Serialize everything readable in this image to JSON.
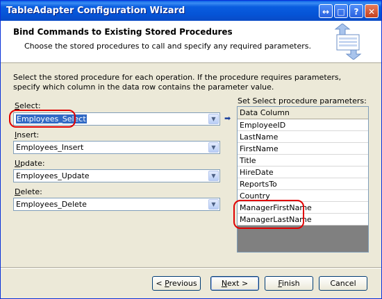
{
  "window": {
    "title": "TableAdapter Configuration Wizard"
  },
  "header": {
    "title": "Bind Commands to Existing Stored Procedures",
    "subtitle": "Choose the stored procedures to call and specify any required parameters."
  },
  "description": "Select the stored procedure for each operation. If the procedure requires parameters, specify which column in the data row contains the parameter value.",
  "fields": {
    "select": {
      "label": "Select:",
      "value": "Employees_Select"
    },
    "insert": {
      "label": "Insert:",
      "value": "Employees_Insert"
    },
    "update": {
      "label": "Update:",
      "value": "Employees_Update"
    },
    "delete": {
      "label": "Delete:",
      "value": "Employees_Delete"
    }
  },
  "params": {
    "label": "Set Select procedure parameters:",
    "column_header": "Data Column",
    "rows": [
      "EmployeeID",
      "LastName",
      "FirstName",
      "Title",
      "HireDate",
      "ReportsTo",
      "Country",
      "ManagerFirstName",
      "ManagerLastName"
    ]
  },
  "buttons": {
    "previous": "< Previous",
    "next": "Next >",
    "finish": "Finish",
    "cancel": "Cancel"
  },
  "colors": {
    "titlebar": "#0a5ee0",
    "highlight": "#316ac5",
    "annotation": "#e00000"
  }
}
